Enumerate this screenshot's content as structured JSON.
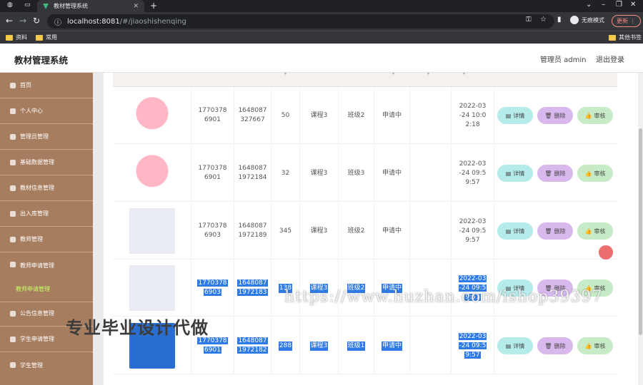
{
  "browser": {
    "tab_title": "教材管理系统",
    "url_host": "localhost:8081",
    "url_path": "/#/jiaoshishenqing",
    "incognito_label": "无痕模式",
    "update_label": "更新",
    "bookmarks": [
      "资料",
      "常用"
    ],
    "other_bookmarks": "其他书签"
  },
  "header": {
    "title": "教材管理系统",
    "admin": "管理员 admin",
    "logout": "退出登录"
  },
  "sidebar": {
    "items": [
      {
        "label": "首页"
      },
      {
        "label": "个人中心"
      },
      {
        "label": "管理员管理"
      },
      {
        "label": "基础数据管理"
      },
      {
        "label": "教材信息管理"
      },
      {
        "label": "出入库管理"
      },
      {
        "label": "教师管理"
      },
      {
        "label": "教师申请管理"
      },
      {
        "label": "公告信息管理"
      },
      {
        "label": "学生申请管理"
      },
      {
        "label": "学生管理"
      }
    ],
    "active_sub": "教师申请管理"
  },
  "actions": {
    "detail": "详情",
    "delete": "删除",
    "audit": "审核"
  },
  "rows": [
    {
      "image": "pink",
      "c1a": "1770378",
      "c1b": "6901",
      "c2a": "1648087",
      "c2b": "327667",
      "qty": "50",
      "course": "课程3",
      "class": "班级2",
      "status": "申请中",
      "t1": "2022-03",
      "t2": "-24 10:0",
      "t3": "2:18"
    },
    {
      "image": "pink",
      "c1a": "1770378",
      "c1b": "6901",
      "c2a": "1648087",
      "c2b": "1972184",
      "qty": "32",
      "course": "课程3",
      "class": "班级3",
      "status": "申请中",
      "t1": "2022-03",
      "t2": "-24 09:5",
      "t3": "9:57"
    },
    {
      "image": "board",
      "c1a": "1770378",
      "c1b": "6903",
      "c2a": "1648087",
      "c2b": "1972189",
      "qty": "345",
      "course": "课程3",
      "class": "班级2",
      "status": "申请中",
      "t1": "2022-03",
      "t2": "-24 09:5",
      "t3": "9:57"
    },
    {
      "image": "board",
      "c1a": "1770378",
      "c1b": "6903",
      "c2a": "1648087",
      "c2b": "1972183",
      "qty": "138",
      "course": "课程3",
      "class": "班级2",
      "status": "申请中",
      "t1": "2022-03",
      "t2": "-24 09:5",
      "t3": "9:57"
    },
    {
      "image": "blue",
      "c1a": "1770378",
      "c1b": "6901",
      "c2a": "1648087",
      "c2b": "1972182",
      "qty": "288",
      "course": "课程3",
      "class": "班级1",
      "status": "申请中",
      "t1": "2022-03",
      "t2": "-24 09:5",
      "t3": "9:57"
    }
  ],
  "watermark": "专业毕业设计代做",
  "watermark_url": "https://www.huzhan.com/ishop39397"
}
